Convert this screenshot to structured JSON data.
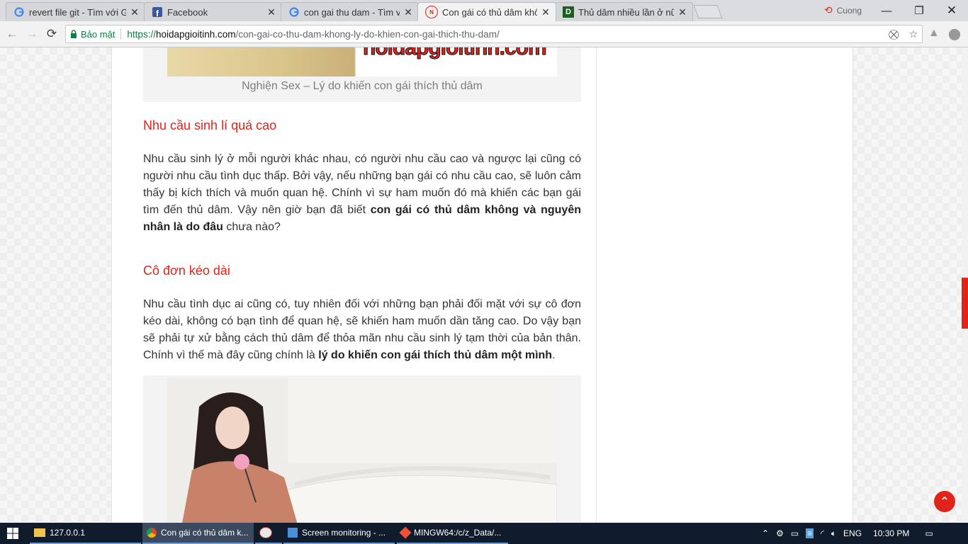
{
  "tabs": [
    {
      "title": "revert file git - Tìm với Go",
      "icon": "google-icon"
    },
    {
      "title": "Facebook",
      "icon": "facebook-icon"
    },
    {
      "title": "con gai thu dam - Tìm vớ",
      "icon": "google-icon"
    },
    {
      "title": "Con gái có thủ dâm khôn",
      "icon": "site-icon"
    },
    {
      "title": "Thủ dâm nhiều lần ở nữ g",
      "icon": "d-site-icon"
    }
  ],
  "profile_name": "Cuong",
  "address": {
    "secure_label": "Bảo mật",
    "scheme": "https://",
    "domain": "hoidapgioitinh.com",
    "path": "/con-gai-co-thu-dam-khong-ly-do-khien-con-gai-thich-thu-dam/"
  },
  "article": {
    "logo_text": "hoidapgioitinh.com",
    "caption1": "Nghiện Sex – Lý do khiến con gái thích thủ dâm",
    "heading1": "Nhu cầu sinh lí quá cao",
    "para1_a": "Nhu cầu sinh lý ở mỗi người khác nhau, có người nhu cầu cao và ngược lại cũng có người nhu cầu tình dục thấp. Bởi vậy, nếu những bạn gái có nhu cầu cao, sẽ luôn cảm thấy bị kích thích và muốn quan hệ. Chính vì sự ham muốn đó mà khiến các bạn gái tìm đến thủ dâm. Vậy nên giờ bạn đã biết ",
    "para1_b": "con gái có thủ dâm không và nguyên nhân là do đâu",
    "para1_c": " chưa nào?",
    "heading2": "Cô đơn kéo dài",
    "para2_a": "Nhu cầu tình dục ai cũng có, tuy nhiên đối với những bạn phải đối mặt với sự cô đơn kéo dài, không có bạn tình để quan hệ, sẽ khiến ham muốn dần tăng cao. Do vậy bạn sẽ phải tự xử bằng cách thủ dâm để thỏa mãn nhu cầu sinh lý tạm thời của bản thân. Chính vì thế mà đây cũng chính là ",
    "para2_b": "lý do khiến con gái thích thủ dâm một mình",
    "para2_c": "."
  },
  "taskbar": {
    "items": [
      {
        "label": "127.0.0.1",
        "icon": "folder-icon"
      },
      {
        "label": "Con gái có thủ dâm k...",
        "icon": "chrome-icon"
      },
      {
        "label": "",
        "icon": "paint-icon"
      },
      {
        "label": "Screen monitoring - ...",
        "icon": "app-icon"
      },
      {
        "label": "MINGW64:/c/z_Data/...",
        "icon": "git-icon"
      }
    ],
    "language": "ENG",
    "time": "10:30 PM"
  },
  "colors": {
    "accent_red": "#e2231a",
    "secure_green": "#0b8043"
  }
}
